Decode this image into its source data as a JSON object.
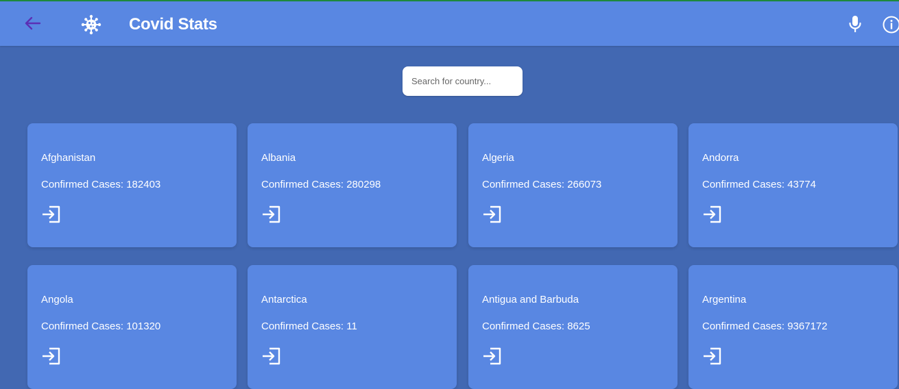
{
  "appbar": {
    "title": "Covid Stats",
    "back_icon": "arrow-left-icon",
    "logo_icon": "virus-icon",
    "mic_icon": "microphone-icon",
    "info_icon": "info-icon",
    "back_color": "#5b2fb5",
    "bar_color": "#5987e2"
  },
  "search": {
    "placeholder": "Search for country...",
    "value": ""
  },
  "cases_label": "Confirmed Cases: ",
  "countries": [
    {
      "name": "Afghanistan",
      "cases": "Confirmed Cases: 182403"
    },
    {
      "name": "Albania",
      "cases": "Confirmed Cases: 280298"
    },
    {
      "name": "Algeria",
      "cases": "Confirmed Cases: 266073"
    },
    {
      "name": "Andorra",
      "cases": "Confirmed Cases: 43774"
    },
    {
      "name": "Angola",
      "cases": "Confirmed Cases: 101320"
    },
    {
      "name": "Antarctica",
      "cases": "Confirmed Cases: 11"
    },
    {
      "name": "Antigua and Barbuda",
      "cases": "Confirmed Cases: 8625"
    },
    {
      "name": "Argentina",
      "cases": "Confirmed Cases: 9367172"
    }
  ],
  "card_icon": "sign-in-icon",
  "colors": {
    "background": "#4268b2",
    "card": "#5987e2",
    "text": "#ffffff"
  }
}
